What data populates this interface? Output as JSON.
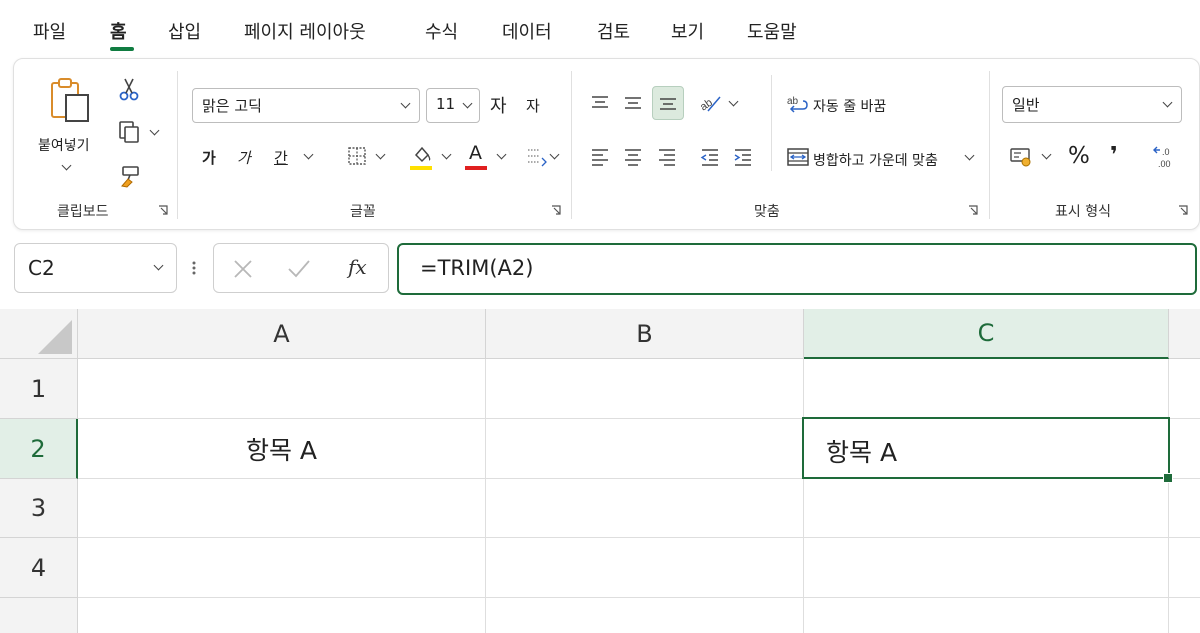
{
  "menu": {
    "tabs": [
      "파일",
      "홈",
      "삽입",
      "페이지 레이아웃",
      "수식",
      "데이터",
      "검토",
      "보기",
      "도움말"
    ],
    "active": "홈"
  },
  "ribbon": {
    "clipboard": {
      "paste_label": "붙여넣기",
      "group_label": "클립보드"
    },
    "font": {
      "font_name": "맑은 고딕",
      "font_size": "11",
      "grow_glyph": "자",
      "shrink_glyph": "자",
      "bold_glyph": "가",
      "italic_glyph": "가",
      "underline_glyph": "간",
      "font_color_glyph": "A",
      "highlight_color": "#ffe000",
      "font_color": "#e02020",
      "group_label": "글꼴"
    },
    "alignment": {
      "wrap_text_label": "자동 줄 바꿈",
      "merge_center_label": "병합하고 가운데 맞춤",
      "group_label": "맞춤"
    },
    "number": {
      "format": "일반",
      "percent_glyph": "%",
      "comma_glyph": "❜",
      "group_label": "표시 형식"
    }
  },
  "formula_bar": {
    "name_box": "C2",
    "fx_label": "fx",
    "formula": "=TRIM(A2)"
  },
  "grid": {
    "columns": [
      "A",
      "B",
      "C"
    ],
    "rows": [
      "1",
      "2",
      "3",
      "4"
    ],
    "selected_cell": "C2",
    "cells": {
      "A2": "항목 A",
      "C2": "항목 A"
    }
  },
  "colors": {
    "accent": "#107c41",
    "selection": "#1e6b3a",
    "selected_header_bg": "#e2efe7"
  }
}
